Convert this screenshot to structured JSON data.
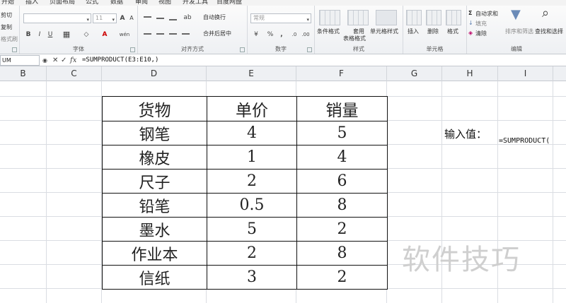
{
  "tabs": [
    "开始",
    "插入",
    "页面布局",
    "公式",
    "数据",
    "审阅",
    "视图",
    "开发工具",
    "百度网盘"
  ],
  "ribbon": {
    "clipboard": {
      "cut": "剪切",
      "copy": "复制",
      "painter": "格式刷"
    },
    "font": {
      "label": "字体",
      "font_size": "11",
      "grow": "A",
      "shrink": "A",
      "bold": "B",
      "italic": "I",
      "underline": "U",
      "font_color": "A",
      "phonetic": "wén"
    },
    "alignment": {
      "label": "对齐方式",
      "wrap": "自动换行",
      "merge": "合并后居中"
    },
    "number": {
      "label": "数字",
      "format": "常规",
      "currency": "¥",
      "percent": "%",
      "comma": ","
    },
    "styles": {
      "label": "样式",
      "conditional": "条件格式",
      "table_format_1": "套用",
      "table_format_2": "表格格式",
      "cell_styles": "单元格样式"
    },
    "cells": {
      "label": "单元格",
      "insert": "插入",
      "delete": "删除",
      "format": "格式"
    },
    "editing": {
      "label": "编辑",
      "autosum": "自动求和",
      "fill": "填充",
      "clear": "清除",
      "sort_filter": "排序和筛选",
      "find_select": "查找和选择"
    }
  },
  "formula_bar": {
    "name_box": "UM",
    "cancel": "✕",
    "enter": "✓",
    "fx": "fx",
    "formula": "=SUMPRODUCT(E3:E10,)"
  },
  "columns": [
    "B",
    "C",
    "D",
    "E",
    "F",
    "G",
    "H",
    "I"
  ],
  "table": {
    "headers": [
      "货物",
      "单价",
      "销量"
    ],
    "rows": [
      [
        "钢笔",
        "4",
        "5"
      ],
      [
        "橡皮",
        "1",
        "4"
      ],
      [
        "尺子",
        "2",
        "6"
      ],
      [
        "铅笔",
        "0.5",
        "8"
      ],
      [
        "墨水",
        "5",
        "2"
      ],
      [
        "作业本",
        "2",
        "8"
      ],
      [
        "信纸",
        "3",
        "2"
      ]
    ]
  },
  "input_label": "输入值：",
  "input_formula": "=SUMPRODUCT(",
  "watermark": "软件技巧"
}
